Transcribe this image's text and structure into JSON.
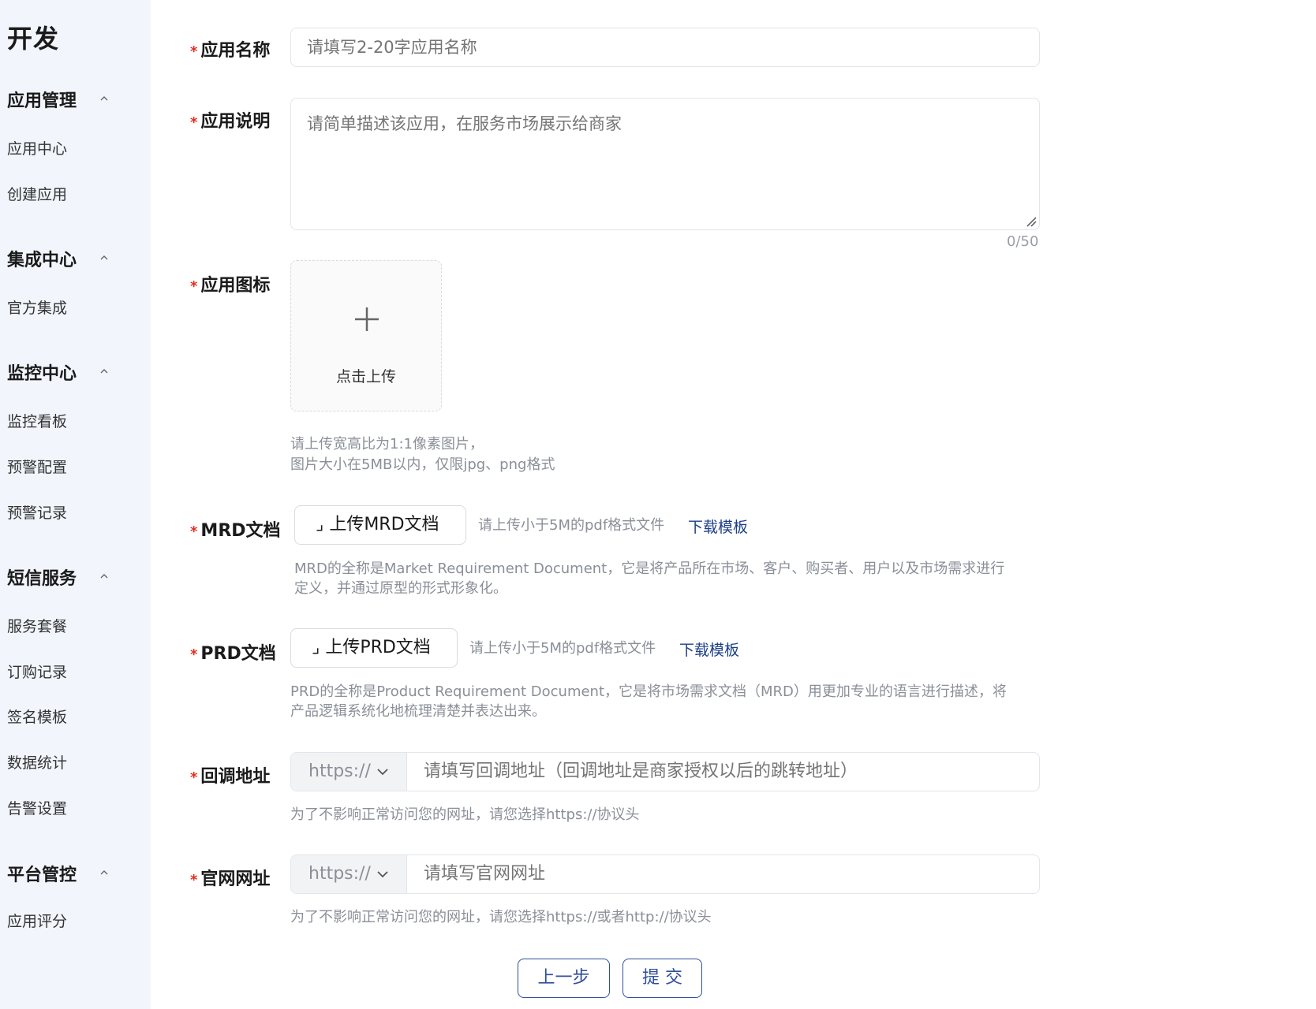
{
  "sidebar": {
    "title": "开发",
    "sections": [
      {
        "label": "应用管理",
        "items": [
          "应用中心",
          "创建应用"
        ]
      },
      {
        "label": "集成中心",
        "items": [
          "官方集成"
        ]
      },
      {
        "label": "监控中心",
        "items": [
          "监控看板",
          "预警配置",
          "预警记录"
        ]
      },
      {
        "label": "短信服务",
        "items": [
          "服务套餐",
          "订购记录",
          "签名模板",
          "数据统计",
          "告警设置"
        ]
      },
      {
        "label": "平台管控",
        "items": [
          "应用评分"
        ]
      }
    ]
  },
  "form": {
    "required_mark": "*",
    "app_name": {
      "label": "应用名称",
      "placeholder": "请填写2-20字应用名称"
    },
    "app_desc": {
      "label": "应用说明",
      "placeholder": "请简单描述该应用，在服务市场展示给商家",
      "counter": "0/50"
    },
    "app_icon": {
      "label": "应用图标",
      "upload_text": "点击上传",
      "hint_line1": "请上传宽高比为1:1像素图片，",
      "hint_line2": "图片大小在5MB以内，仅限jpg、png格式"
    },
    "mrd": {
      "label": "MRD文档",
      "button": "上传MRD文档",
      "hint": "请上传小于5M的pdf格式文件",
      "template_link": "下载模板",
      "desc_line1": "MRD的全称是Market Requirement Document，它是将产品所在市场、客户、购买者、用户以及市场需求进行",
      "desc_line2": "定义，并通过原型的形式形象化。"
    },
    "prd": {
      "label": "PRD文档",
      "button": "上传PRD文档",
      "hint": "请上传小于5M的pdf格式文件",
      "template_link": "下载模板",
      "desc_line1": "PRD的全称是Product Requirement Document，它是将市场需求文档（MRD）用更加专业的语言进行描述，将",
      "desc_line2": "产品逻辑系统化地梳理清楚并表达出来。"
    },
    "callback": {
      "label": "回调地址",
      "protocol": "https://",
      "placeholder": "请填写回调地址（回调地址是商家授权以后的跳转地址）",
      "hint": "为了不影响正常访问您的网址，请您选择https://协议头"
    },
    "website": {
      "label": "官网网址",
      "protocol": "https://",
      "placeholder": "请填写官网网址",
      "hint": "为了不影响正常访问您的网址，请您选择https://或者http://协议头"
    }
  },
  "actions": {
    "prev": "上一步",
    "submit": "提 交"
  },
  "colors": {
    "sidebar_bg": "#f2f5fc",
    "required": "#e02e24",
    "link": "#1c3f86",
    "primary_border": "#2f4f9a"
  }
}
